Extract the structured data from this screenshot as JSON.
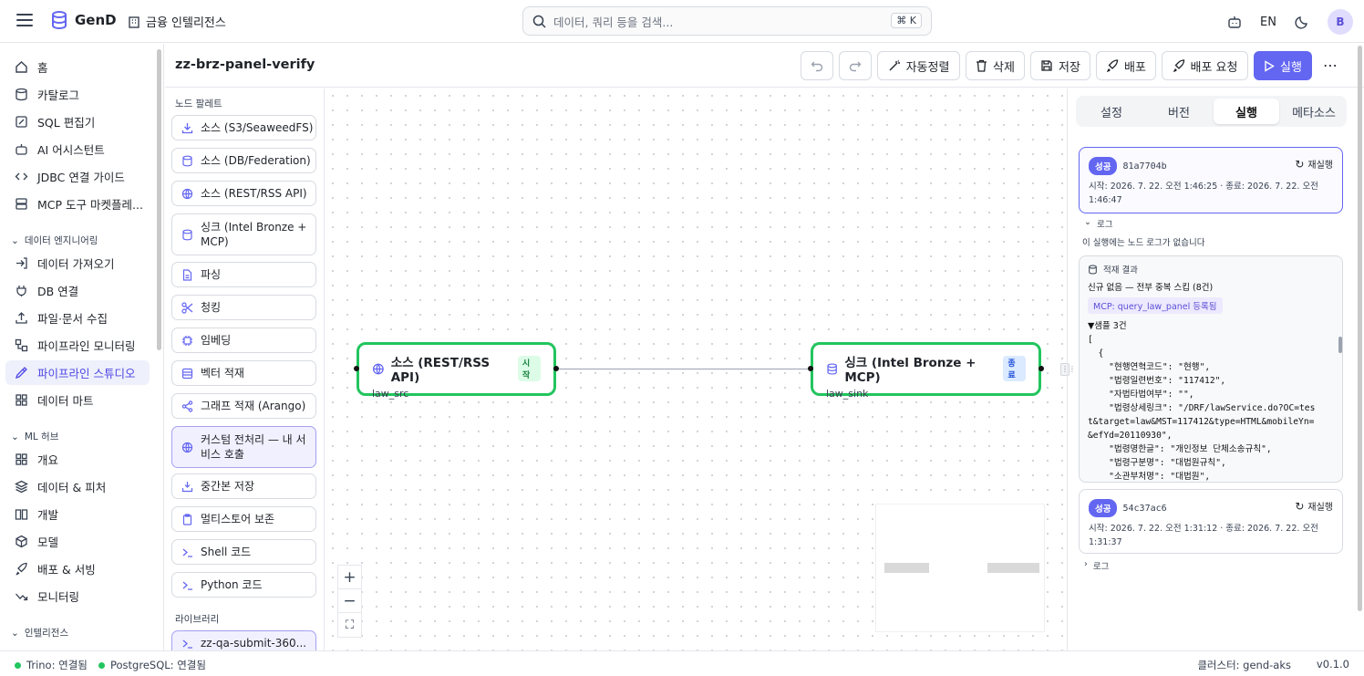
{
  "app": {
    "name": "GenD",
    "workspace": "금융 인텔리전스",
    "language": "EN",
    "avatar": "B"
  },
  "search": {
    "placeholder": "데이터, 쿼리 등을 검색...",
    "shortcut": "⌘ K"
  },
  "sidebar": {
    "items_top": [
      {
        "label": "홈",
        "icon": "home-icon"
      },
      {
        "label": "카탈로그",
        "icon": "database-icon"
      },
      {
        "label": "SQL 편집기",
        "icon": "edit-icon"
      },
      {
        "label": "AI 어시스턴트",
        "icon": "bot-icon"
      },
      {
        "label": "JDBC 연결 가이드",
        "icon": "code-icon"
      },
      {
        "label": "MCP 도구 마켓플레...",
        "icon": "server-icon"
      }
    ],
    "section_data_eng": "데이터 엔지니어링",
    "items_data_eng": [
      {
        "label": "데이터 가져오기",
        "icon": "import-icon"
      },
      {
        "label": "DB 연결",
        "icon": "plug-icon"
      },
      {
        "label": "파일·문서 수집",
        "icon": "upload-icon"
      },
      {
        "label": "파이프라인 모니터링",
        "icon": "workflow-icon"
      },
      {
        "label": "파이프라인 스튜디오",
        "icon": "studio-icon",
        "active": true
      },
      {
        "label": "데이터 마트",
        "icon": "grid-icon"
      }
    ],
    "section_ml": "ML 허브",
    "items_ml": [
      {
        "label": "개요",
        "icon": "grid-icon"
      },
      {
        "label": "데이터 & 피처",
        "icon": "layers-icon"
      },
      {
        "label": "개발",
        "icon": "book-icon"
      },
      {
        "label": "모델",
        "icon": "cube-icon"
      },
      {
        "label": "배포 & 서빙",
        "icon": "rocket-icon"
      },
      {
        "label": "모니터링",
        "icon": "trend-icon"
      }
    ],
    "section_intel": "인텔리전스"
  },
  "pipeline": {
    "name": "zz-brz-panel-verify"
  },
  "toolbar": {
    "autoalign": "자동정렬",
    "delete": "삭제",
    "save": "저장",
    "deploy": "배포",
    "deploy_request": "배포 요청",
    "run": "실행"
  },
  "palette": {
    "title": "노드 팔레트",
    "items": [
      {
        "label": "소스 (S3/SeaweedFS)",
        "icon": "download-icon"
      },
      {
        "label": "소스 (DB/Federation)",
        "icon": "database-icon"
      },
      {
        "label": "소스 (REST/RSS API)",
        "icon": "globe-icon"
      },
      {
        "label": "싱크 (Intel Bronze + MCP)",
        "icon": "database-icon"
      },
      {
        "label": "파싱",
        "icon": "file-icon"
      },
      {
        "label": "청킹",
        "icon": "scissors-icon"
      },
      {
        "label": "임베딩",
        "icon": "cpu-icon"
      },
      {
        "label": "벡터 적재",
        "icon": "db-stack-icon"
      },
      {
        "label": "그래프 적재 (Arango)",
        "icon": "share-icon"
      },
      {
        "label": "커스텀 전처리 — 내 서비스 호출",
        "icon": "globe-icon",
        "highlight": true
      },
      {
        "label": "중간본 저장",
        "icon": "save-down-icon"
      },
      {
        "label": "멀티스토어 보존",
        "icon": "clipboard-icon"
      },
      {
        "label": "Shell 코드",
        "icon": "terminal-icon"
      },
      {
        "label": "Python 코드",
        "icon": "terminal-icon"
      }
    ],
    "library_title": "라이브러리",
    "library_items": [
      {
        "label": "zz-qa-submit-360...",
        "icon": "terminal-icon"
      }
    ]
  },
  "canvas": {
    "nodes": [
      {
        "title": "소스 (REST/RSS API)",
        "tag": "시작",
        "subtitle": "law_src",
        "icon": "globe-icon"
      },
      {
        "title": "싱크 (Intel Bronze + MCP)",
        "tag": "종료",
        "subtitle": "law_sink",
        "icon": "database-icon"
      }
    ],
    "zoom": {
      "in": "+",
      "out": "−",
      "fit": "⛶"
    }
  },
  "right_panel": {
    "tabs": [
      "설정",
      "버전",
      "실행",
      "메타소스"
    ],
    "active_tab": "실행",
    "runs": [
      {
        "status": "성공",
        "id": "81a7704b",
        "rerun": "재실행",
        "times": "시작: 2026. 7. 22. 오전 1:46:25 · 종료: 2026. 7. 22. 오전 1:46:47",
        "log_label": "로그",
        "log_note": "이 실행에는 노드 로그가 없습니다"
      },
      {
        "status": "성공",
        "id": "54c37ac6",
        "rerun": "재실행",
        "times": "시작: 2026. 7. 22. 오전 1:31:12 · 종료: 2026. 7. 22. 오전 1:31:37",
        "log_label": "로그"
      }
    ],
    "result": {
      "title": "적재 결과",
      "summary": "신규 없음 — 전부 중복 스킵 (8건)",
      "mcp": "MCP: query_law_panel 등록됨",
      "sample_label": "▼샘플 3건",
      "json": "[\n  {\n    \"현행연혁코드\": \"현행\",\n    \"법령일련번호\": \"117412\",\n    \"자법타법여부\": \"\",\n    \"법령상세링크\": \"/DRF/lawService.do?OC=tes\nt&target=law&MST=117412&type=HTML&mobileYn=\n&efYd=20110930\",\n    \"법령명한글\": \"개인정보 단체소송규칙\",\n    \"법령구분명\": \"대법원규칙\",\n    \"소관부처명\": \"대법원\","
    }
  },
  "statusbar": {
    "trino": "Trino: 연결됨",
    "postgres": "PostgreSQL: 연결됨",
    "cluster": "클러스터: gend-aks",
    "version": "v0.1.0"
  },
  "colors": {
    "accent": "#6366f1",
    "success": "#22c55e",
    "node_border": "#22c55e"
  }
}
